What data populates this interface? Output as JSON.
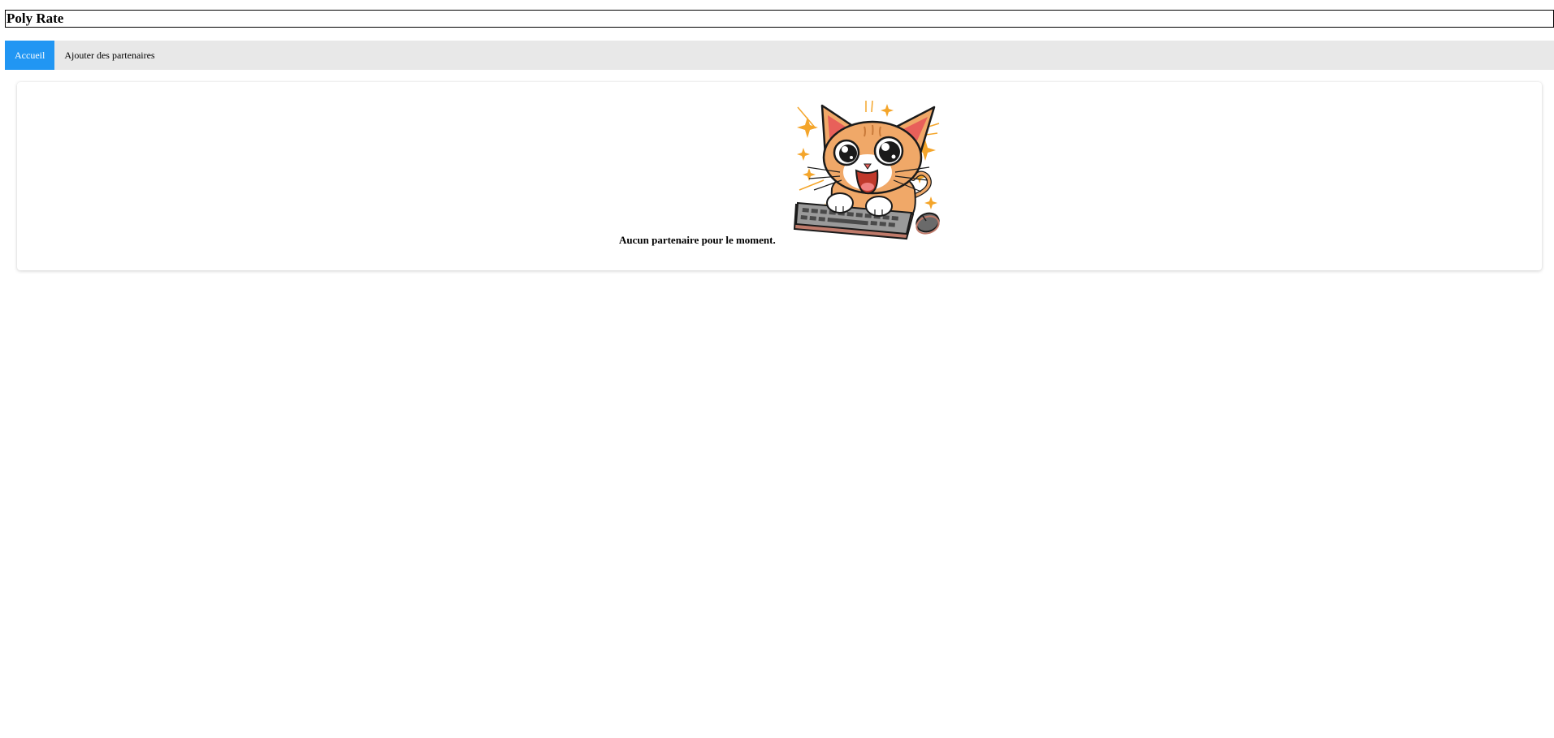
{
  "header": {
    "title": "Poly Rate"
  },
  "nav": {
    "items": [
      {
        "label": "Accueil",
        "active": true
      },
      {
        "label": "Ajouter des partenaires",
        "active": false
      }
    ]
  },
  "main": {
    "empty_message": "Aucun partenaire pour le moment.",
    "illustration": "excited-cat-at-keyboard-illustration"
  },
  "colors": {
    "nav_active_bg": "#2196f3",
    "nav_bar_bg": "#e8e8e8",
    "cat_orange": "#f0a868",
    "ear_pink": "#e8605a",
    "sparkle": "#f4a52a"
  }
}
